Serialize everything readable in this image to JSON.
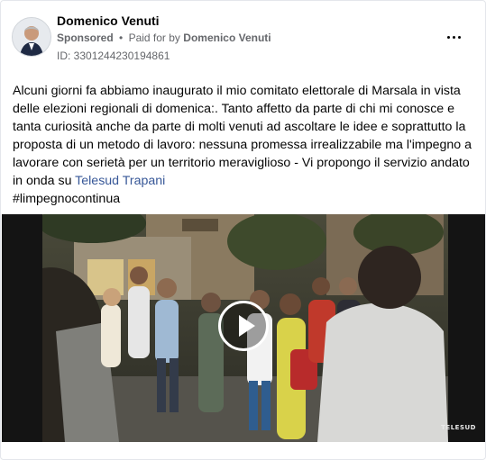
{
  "post": {
    "author": "Domenico Venuti",
    "sponsored": "Sponsored",
    "paid_prefix": "Paid for by",
    "paid_by": "Domenico Venuti",
    "ad_id": "ID: 3301244230194861",
    "body_text": "Alcuni giorni fa abbiamo inaugurato il mio comitato elettorale di Marsala in vista delle elezioni regionali di domenica:. Tanto affetto da parte di chi mi conosce e tanta curiosità anche da parte di molti venuti ad ascoltare le idee e soprattutto la proposta di un metodo di lavoro: nessuna promessa irrealizzabile ma l'impegno a lavorare con serietà per un territorio meraviglioso - Vi propongo il servizio andato in onda su ",
    "body_link": "Telesud Trapani",
    "hashtag": "#limpegnocontinua"
  },
  "video": {
    "watermark": "TELESUD",
    "play_icon": "play-icon"
  },
  "icons": {
    "more": "more-options-icon",
    "avatar": "profile-photo"
  },
  "colors": {
    "link": "#385898",
    "meta": "#65676b",
    "text": "#050505"
  }
}
